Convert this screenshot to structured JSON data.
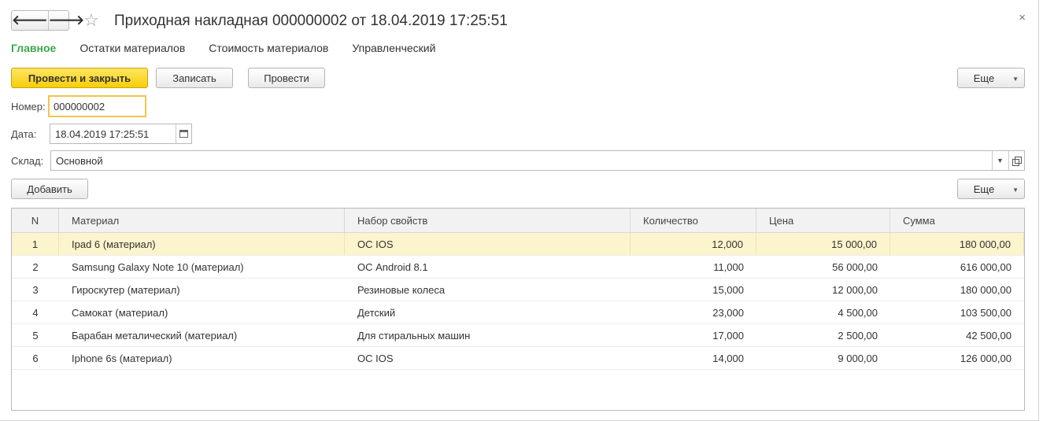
{
  "window": {
    "title": "Приходная накладная 000000002 от 18.04.2019 17:25:51",
    "back_icon": "arrow-left-icon",
    "forward_icon": "arrow-right-icon",
    "favorite_icon": "star-icon",
    "close_icon": "close-icon",
    "back_glyph": "🡐",
    "forward_glyph": "🡒",
    "star_glyph": "☆",
    "close_glyph": "×"
  },
  "tabs": [
    {
      "label": "Главное",
      "active": true
    },
    {
      "label": "Остатки материалов",
      "active": false
    },
    {
      "label": "Стоимость материалов",
      "active": false
    },
    {
      "label": "Управленческий",
      "active": false
    }
  ],
  "toolbar": {
    "post_and_close": "Провести и закрыть",
    "save": "Записать",
    "post": "Провести",
    "more": "Еще"
  },
  "form": {
    "number_label": "Номер:",
    "number_value": "000000002",
    "date_label": "Дата:",
    "date_value": "18.04.2019 17:25:51",
    "warehouse_label": "Склад:",
    "warehouse_value": "Основной"
  },
  "table_toolbar": {
    "add": "Добавить",
    "more": "Еще"
  },
  "colors": {
    "accent_tab": "#3aa84b",
    "primary_button": "#f6cf08",
    "selected_row": "#fbf4cc",
    "focus_border": "#f2c64b"
  },
  "table": {
    "columns": [
      "N",
      "Материал",
      "Набор свойств",
      "Количество",
      "Цена",
      "Сумма"
    ],
    "selected_row": 0,
    "rows": [
      {
        "n": "1",
        "material": "Ipad 6 (материал)",
        "properties": "ОС IOS",
        "quantity": "12,000",
        "price": "15 000,00",
        "sum": "180 000,00"
      },
      {
        "n": "2",
        "material": "Samsung Galaxy Note 10 (материал)",
        "properties": "ОС Android 8.1",
        "quantity": "11,000",
        "price": "56 000,00",
        "sum": "616 000,00"
      },
      {
        "n": "3",
        "material": "Гироскутер (материал)",
        "properties": "Резиновые колеса",
        "quantity": "15,000",
        "price": "12 000,00",
        "sum": "180 000,00"
      },
      {
        "n": "4",
        "material": "Самокат (материал)",
        "properties": "Детский",
        "quantity": "23,000",
        "price": "4 500,00",
        "sum": "103 500,00"
      },
      {
        "n": "5",
        "material": "Барабан металический (материал)",
        "properties": "Для стиральных машин",
        "quantity": "17,000",
        "price": "2 500,00",
        "sum": "42 500,00"
      },
      {
        "n": "6",
        "material": "Iphone 6s (материал)",
        "properties": "ОС IOS",
        "quantity": "14,000",
        "price": "9 000,00",
        "sum": "126 000,00"
      }
    ]
  }
}
